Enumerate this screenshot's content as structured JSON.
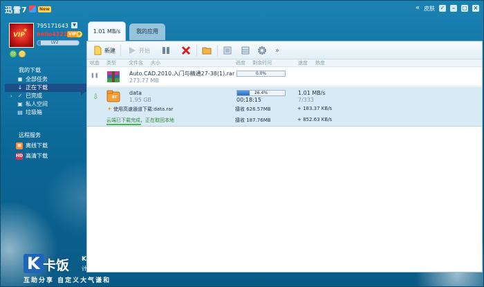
{
  "window": {
    "title": "迅雷7",
    "badge": "New"
  },
  "title_controls": {
    "back": "«",
    "skin_label": "皮肤",
    "checkbox": "✓",
    "minimize": "–",
    "maximize": "□",
    "close": "×"
  },
  "user": {
    "id": "795171643",
    "username": "hello4321",
    "vip_badge": "VIP1",
    "add_badge": "+",
    "level_label": "LV2",
    "level_progress": 0.08,
    "avatar_text": "VIP"
  },
  "sidebar": {
    "my_downloads": "我的下载",
    "items": [
      {
        "label": "全部任务",
        "icon": "all-tasks-icon",
        "glyph": "◼"
      },
      {
        "label": "正在下载",
        "icon": "downloading-icon",
        "glyph": "↓"
      },
      {
        "label": "已完成",
        "icon": "completed-icon",
        "glyph": "✓",
        "chevron": "›"
      },
      {
        "label": "私人空间",
        "icon": "lock-icon",
        "glyph": "▣"
      },
      {
        "label": "垃圾箱",
        "icon": "trash-icon",
        "glyph": "▤"
      }
    ],
    "remote_head": "远程服务",
    "remote_items": [
      {
        "label": "离线下载",
        "icon": "offline-download-icon",
        "glyph": "▦"
      },
      {
        "label": "高清下载",
        "icon": "hd-download-icon",
        "glyph": "HD"
      }
    ]
  },
  "tabs": [
    {
      "label": "1.01 MB/s"
    },
    {
      "label": "我的应用"
    }
  ],
  "toolbar": {
    "new_label": "新建",
    "start_label": "开始",
    "more": "»"
  },
  "columns": {
    "status": "状态",
    "type": "类型",
    "filename": "文件名",
    "size": "大小",
    "progress": "进度",
    "remaining": "剩余时间",
    "speed": "速度",
    "heat": "热度"
  },
  "tasks": [
    {
      "name": "Auto.CAD.2010.入门与精通27-38(1).rar",
      "size": "273.77 MB",
      "progress": 0.0,
      "progress_label": "0.0%",
      "status_glyph": "❚❚"
    },
    {
      "name": "data",
      "size": "1.95 GB",
      "progress": 0.26,
      "progress_label": "26.4%",
      "remaining": "00:18:15",
      "speed": "1.01 MB/s",
      "peers": "7/333",
      "file_type": "BT",
      "status_glyph": "⇩",
      "accel_label": "使用高速通道下载:data.rar",
      "accel_received": "接收 626.57MB",
      "accel_speed": "+ 183.37 KB/s",
      "cloud_label": "云端已下载完成，正在取回本地",
      "cloud_received": "接收 187.76MB",
      "cloud_speed": "+ 852.63 KB/s"
    }
  ],
  "watermark": {
    "logo_letter": "K",
    "brand": "卡饭",
    "domain": "KaFan.CN",
    "sub": "计算机安全",
    "slogan": "互助分享 自定义大气谦和"
  },
  "colors": {
    "accent": "#1c4e86",
    "progress": "#2f6fc2",
    "cloud_green": "#2c8d2c",
    "username": "#ff3b3b"
  }
}
